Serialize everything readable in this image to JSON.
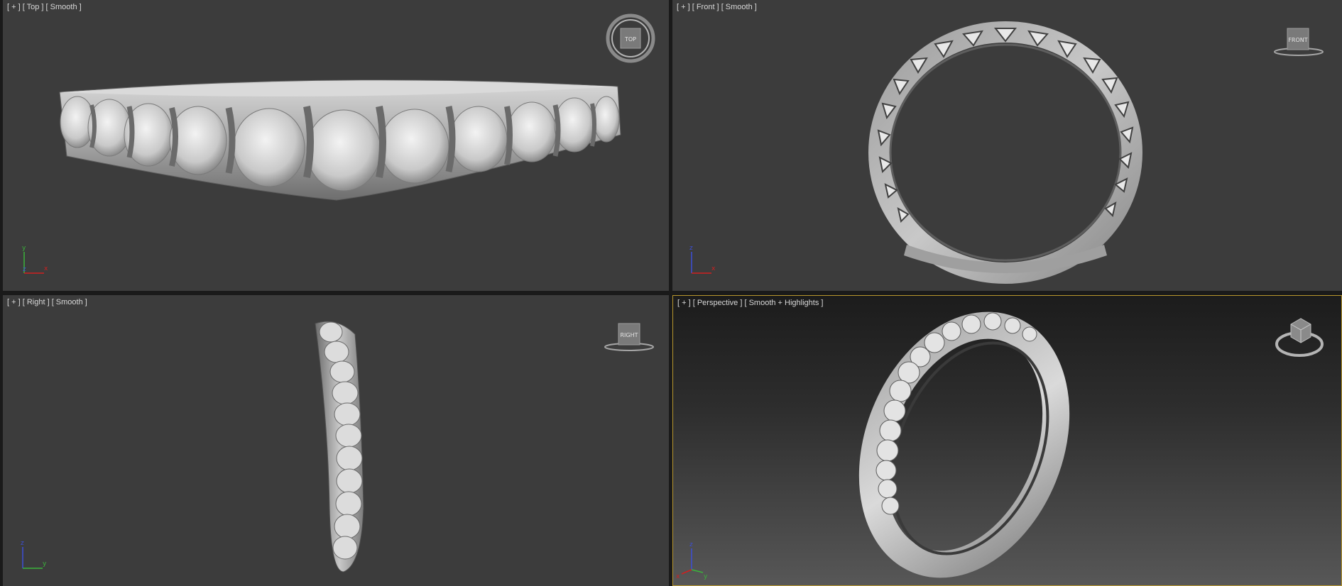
{
  "viewports": [
    {
      "id": "top",
      "menu": "[ + ]",
      "view": "[ Top ]",
      "shading": "[ Smooth ]",
      "cube_label": "TOP",
      "gizmo_axes": [
        "x",
        "y",
        "z"
      ]
    },
    {
      "id": "front",
      "menu": "[ + ]",
      "view": "[ Front ]",
      "shading": "[ Smooth ]",
      "cube_label": "FRONT",
      "gizmo_axes": [
        "x",
        "z"
      ]
    },
    {
      "id": "right",
      "menu": "[ + ]",
      "view": "[ Right ]",
      "shading": "[ Smooth ]",
      "cube_label": "RIGHT",
      "gizmo_axes": [
        "y",
        "z"
      ]
    },
    {
      "id": "perspective",
      "menu": "[ + ]",
      "view": "[ Perspective ]",
      "shading": "[ Smooth + Highlights ]",
      "cube_label": "",
      "gizmo_axes": [
        "x",
        "y",
        "z"
      ],
      "active": true
    }
  ],
  "colors": {
    "background": "#1a1a1a",
    "viewport_bg": "#3c3c3c",
    "active_border": "#b7962d",
    "label_text": "#d8d8d8",
    "model": "#b9b9b9",
    "axis_x": "#d02020",
    "axis_y": "#3bb33b",
    "axis_z": "#3d4fd6"
  },
  "icons": {
    "viewcube": "viewcube-icon",
    "axis_gizmo": "axis-tripod-icon"
  }
}
